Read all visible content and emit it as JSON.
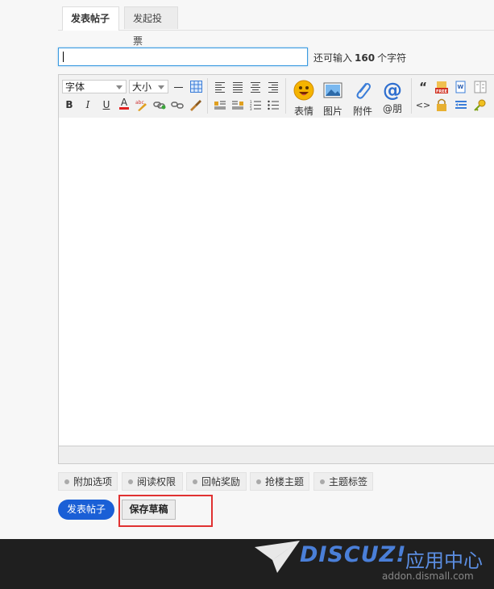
{
  "tabs": [
    {
      "label": "发表帖子",
      "active": true
    },
    {
      "label": "发起投票",
      "active": false
    }
  ],
  "title_field": {
    "value": "",
    "counter_prefix": "还可输入",
    "counter_value": "160",
    "counter_suffix": "个字符"
  },
  "toolbar": {
    "font_select": "字体",
    "size_select": "大小",
    "bold": "B",
    "italic": "I",
    "underline": "U",
    "font_color": "A",
    "emoticon": "表情",
    "image": "图片",
    "attachment": "附件",
    "at_friend": "@朋",
    "quote": "“",
    "code": "<>"
  },
  "options": [
    "附加选项",
    "阅读权限",
    "回帖奖励",
    "抢楼主题",
    "主题标签"
  ],
  "buttons": {
    "post": "发表帖子",
    "save_draft": "保存草稿"
  },
  "footer": {
    "brand": "DISCUZ!",
    "brand_cn": "应用中心",
    "url": "addon.dismall.com"
  },
  "colors": {
    "primary_button": "#1a5fd6",
    "highlight": "#e03131",
    "footer_bg": "#1f1f1f"
  }
}
